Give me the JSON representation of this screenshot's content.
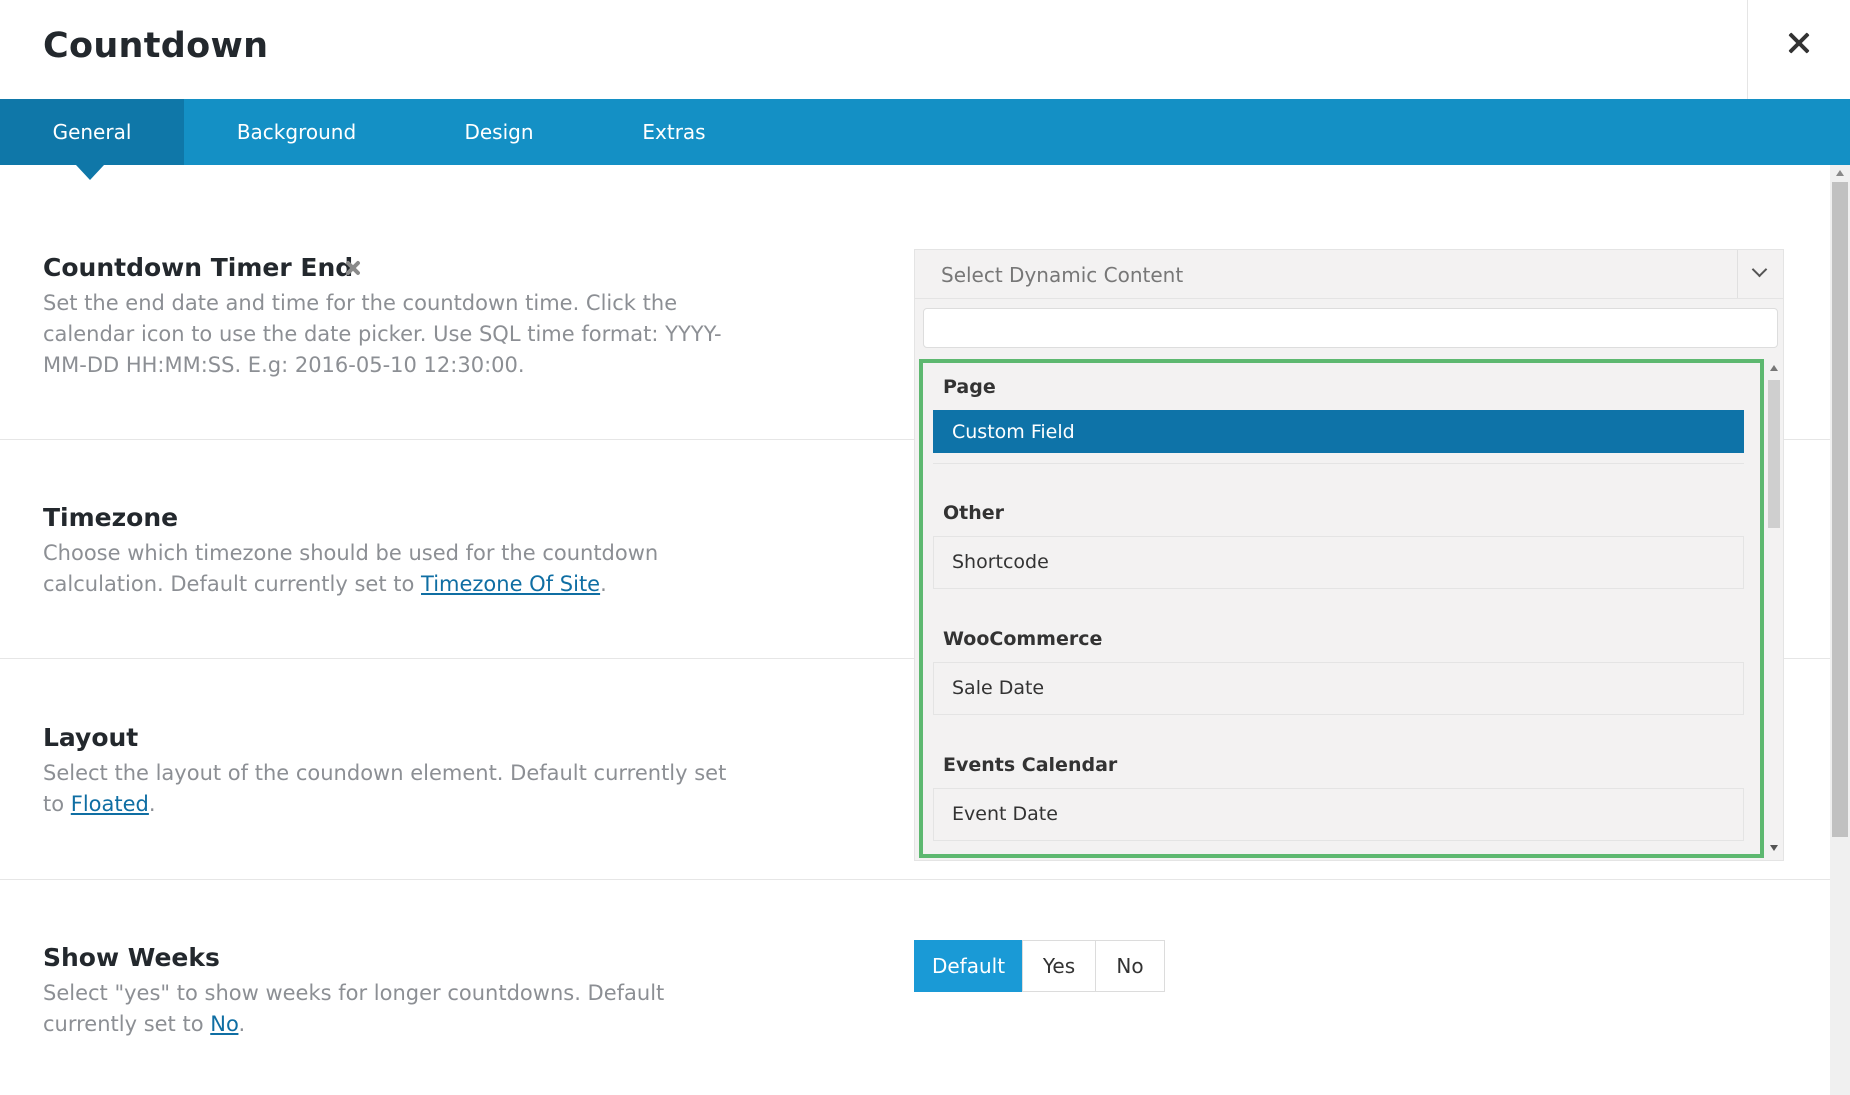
{
  "window": {
    "title": "Countdown",
    "close_icon": "close-icon"
  },
  "tabs": [
    {
      "label": "General",
      "active": true
    },
    {
      "label": "Background",
      "active": false
    },
    {
      "label": "Design",
      "active": false
    },
    {
      "label": "Extras",
      "active": false
    }
  ],
  "settings": {
    "timer_end": {
      "label": "Countdown Timer End",
      "description": "Set the end date and time for the countdown time. Click the calendar icon to use the date picker. Use SQL time format: YYYY-MM-DD HH:MM:SS. E.g: 2016-05-10 12:30:00.",
      "reset_icon": "reset-x-icon"
    },
    "timezone": {
      "label": "Timezone",
      "description_prefix": "Choose which timezone should be used for the countdown calculation. Default currently set to ",
      "default_link": "Timezone Of Site",
      "description_suffix": "."
    },
    "layout": {
      "label": "Layout",
      "description_prefix": "Select the layout of the coundown element. Default currently set to ",
      "default_link": "Floated",
      "description_suffix": "."
    },
    "show_weeks": {
      "label": "Show Weeks",
      "description_prefix": "Select \"yes\" to show weeks for longer countdowns. Default currently set to ",
      "default_link": "No",
      "description_suffix": ".",
      "options": [
        "Default",
        "Yes",
        "No"
      ],
      "selected": "Default"
    }
  },
  "dynamic_select": {
    "placeholder": "Select Dynamic Content",
    "search_value": "",
    "groups": [
      {
        "label": "Page",
        "options": [
          "Custom Field"
        ]
      },
      {
        "label": "Other",
        "options": [
          "Shortcode"
        ]
      },
      {
        "label": "WooCommerce",
        "options": [
          "Sale Date"
        ]
      },
      {
        "label": "Events Calendar",
        "options": [
          "Event Date"
        ]
      }
    ],
    "highlighted": "Custom Field"
  },
  "colors": {
    "tab_bar": "#1490c5",
    "tab_active": "#0f77a8",
    "highlight_option": "#0e73a8",
    "focus_outline": "#5db870",
    "button_active": "#1a9ad6"
  }
}
